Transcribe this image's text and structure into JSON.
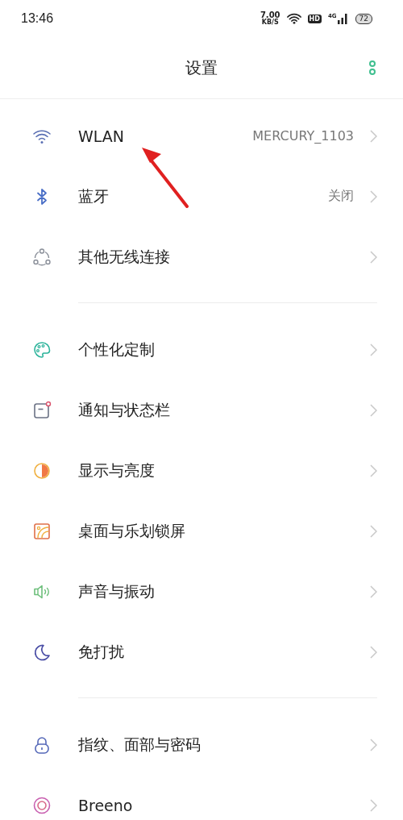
{
  "status_bar": {
    "time": "13:46",
    "speed": "7.00",
    "speed_unit": "KB/S",
    "hd": "HD",
    "network": "4G",
    "battery": "72"
  },
  "header": {
    "title": "设置"
  },
  "sections": [
    {
      "items": [
        {
          "label": "WLAN",
          "value": "MERCURY_1103"
        },
        {
          "label": "蓝牙",
          "value": "关闭"
        },
        {
          "label": "其他无线连接"
        }
      ]
    },
    {
      "items": [
        {
          "label": "个性化定制"
        },
        {
          "label": "通知与状态栏"
        },
        {
          "label": "显示与亮度"
        },
        {
          "label": "桌面与乐划锁屏"
        },
        {
          "label": "声音与振动"
        },
        {
          "label": "免打扰"
        }
      ]
    },
    {
      "items": [
        {
          "label": "指纹、面部与密码"
        },
        {
          "label": "Breeno"
        }
      ]
    }
  ]
}
